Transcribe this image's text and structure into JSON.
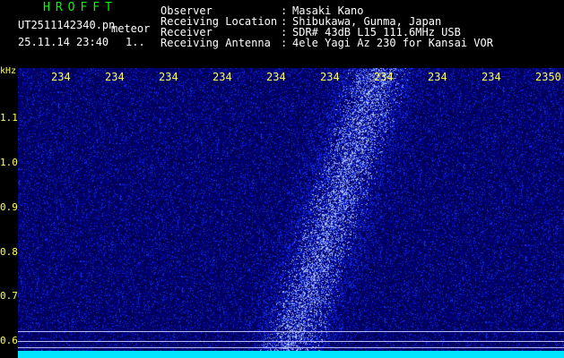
{
  "header": {
    "program": "HROFFT",
    "filename": "UT2511142340.pn",
    "tag": "meteor",
    "datetime": "25.11.14 23:40",
    "counter": "1..",
    "fields": [
      {
        "label": "Observer",
        "value": "Masaki Kano"
      },
      {
        "label": "Receiving Location",
        "value": "Shibukawa, Gunma, Japan"
      },
      {
        "label": "Receiver",
        "value": "SDR# 43dB L15 111.6MHz USB"
      },
      {
        "label": "Receiving Antenna",
        "value": "4ele Yagi Az 230 for Kansai VOR"
      }
    ],
    "colon": ":"
  },
  "axes": {
    "y_unit": "kHz",
    "x_ticks": [
      "234",
      "234",
      "234",
      "234",
      "234",
      "234",
      "234",
      "234",
      "234",
      "2350"
    ],
    "y_ticks": [
      "1.1",
      "1.0",
      "0.9",
      "0.8",
      "0.7",
      "0.6"
    ]
  },
  "colors": {
    "background": "#000000",
    "title": "#00ff00",
    "ticks": "#ffff55",
    "plot_bg": "#00004a",
    "baseline": "#00e5ff"
  }
}
